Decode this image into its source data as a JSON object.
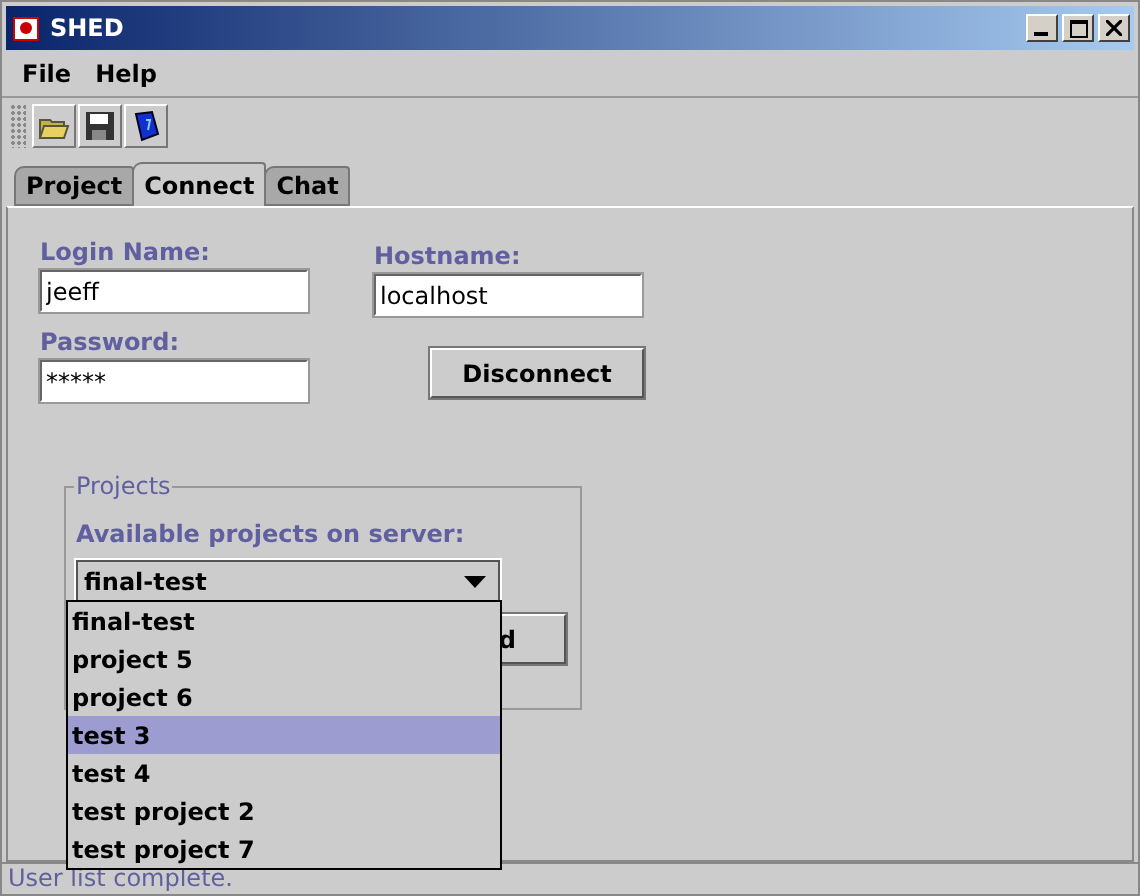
{
  "window": {
    "title": "SHED"
  },
  "menu": [
    "File",
    "Help"
  ],
  "tabs": [
    {
      "label": "Project",
      "selected": false
    },
    {
      "label": "Connect",
      "selected": true
    },
    {
      "label": "Chat",
      "selected": false
    }
  ],
  "login": {
    "label": "Login Name:",
    "value": "jeeff"
  },
  "hostname": {
    "label": "Hostname:",
    "value": "localhost"
  },
  "password": {
    "label": "Password:",
    "value": "*****"
  },
  "disconnect_button": "Disconnect",
  "projects": {
    "title": "Projects",
    "label": "Available projects on server:",
    "combo_value": "final-test",
    "button_fragment": "d",
    "options": [
      {
        "label": "final-test",
        "selected": false
      },
      {
        "label": "project 5",
        "selected": false
      },
      {
        "label": "project 6",
        "selected": false
      },
      {
        "label": "test 3",
        "selected": true
      },
      {
        "label": "test 4",
        "selected": false
      },
      {
        "label": "test project 2",
        "selected": false
      },
      {
        "label": "test project 7",
        "selected": false
      }
    ]
  },
  "status_bar": "User list complete."
}
